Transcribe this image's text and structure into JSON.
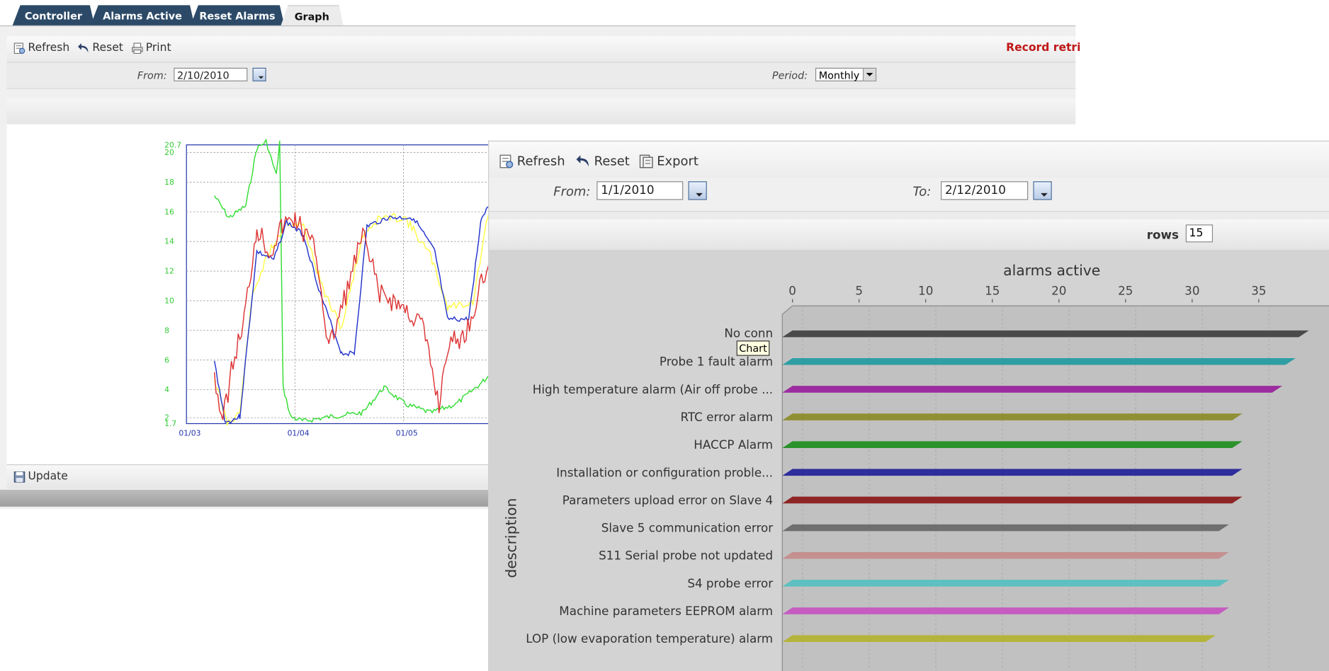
{
  "tabs": [
    "Controller",
    "Alarms Active",
    "Reset Alarms",
    "Graph"
  ],
  "active_tab": "Graph",
  "toolbar_a": {
    "refresh": "Refresh",
    "reset": "Reset",
    "print": "Print",
    "status": "Record retri"
  },
  "filter_a": {
    "from_label": "From:",
    "from_value": "2/10/2010",
    "period_label": "Period:",
    "period_value": "Monthly"
  },
  "footer_a": {
    "update": "Update"
  },
  "line_chart": {
    "ytick_labels": [
      "20.7",
      "20",
      "18",
      "16",
      "14",
      "12",
      "10",
      "8",
      "6",
      "4",
      "2",
      "1.7"
    ],
    "xtick_labels": [
      "01/03",
      "01/04",
      "01/05"
    ],
    "series_colors": {
      "green": "#33dd33",
      "yellow": "#ffff44",
      "blue": "#2233cc",
      "red": "#dd3333"
    }
  },
  "toolbar_b": {
    "refresh": "Refresh",
    "reset": "Reset",
    "export": "Export"
  },
  "filter_b": {
    "from_label": "From:",
    "from_value": "1/1/2010",
    "to_label": "To:",
    "to_value": "2/12/2010"
  },
  "rows": {
    "label": "rows",
    "value": "15"
  },
  "tooltip": "Chart",
  "chart_data": {
    "type": "bar",
    "title": "alarms active",
    "xlabel": "",
    "ylabel": "description",
    "orientation": "horizontal",
    "xlim": [
      0,
      38
    ],
    "xticks": [
      0,
      5,
      10,
      15,
      20,
      25,
      30,
      35
    ],
    "categories": [
      "No conn",
      "Probe 1 fault alarm",
      "High temperature alarm (Air off probe ...",
      "RTC error alarm",
      "HACCP Alarm",
      "Installation or configuration proble...",
      "Parameters upload error on Slave 4",
      "Slave 5 communication error",
      "S11 Serial probe not updated",
      "S4 probe error",
      "Machine parameters EEPROM alarm",
      "LOP (low evaporation temperature) alarm"
    ],
    "values": [
      38,
      37,
      36,
      33,
      33,
      33,
      33,
      32,
      32,
      32,
      32,
      31
    ],
    "colors": [
      "#4a4a4a",
      "#2e9ea4",
      "#9c2ca0",
      "#8f8f34",
      "#2b922b",
      "#2d2d9c",
      "#8e2626",
      "#6f6f6f",
      "#c49090",
      "#5ec0c0",
      "#c55cc0",
      "#b4b43c"
    ]
  }
}
